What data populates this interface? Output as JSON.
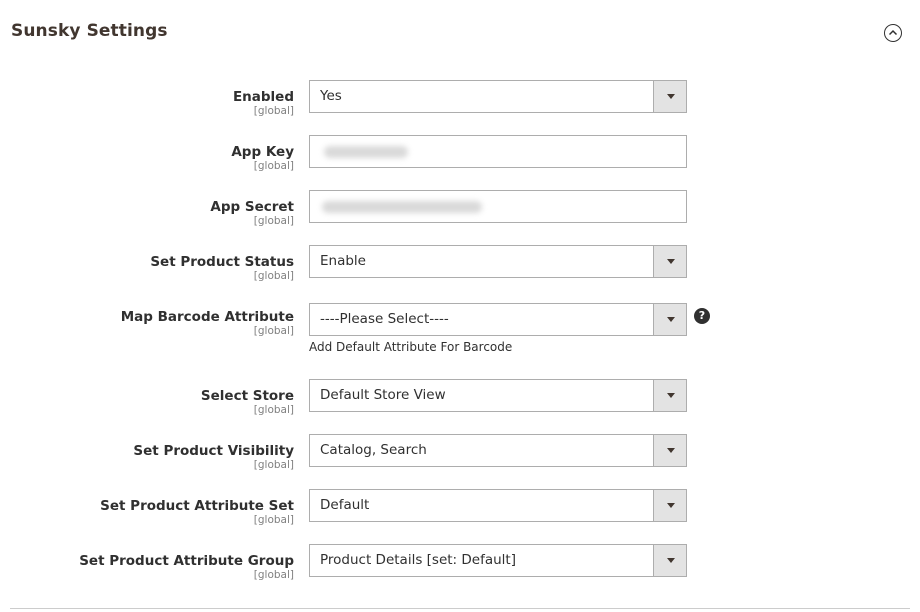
{
  "section": {
    "title": "Sunsky Settings",
    "collapse_icon": "chevron-up-circle-icon"
  },
  "fields": {
    "enabled": {
      "label": "Enabled",
      "scope": "[global]",
      "value": "Yes"
    },
    "app_key": {
      "label": "App Key",
      "scope": "[global]"
    },
    "app_secret": {
      "label": "App Secret",
      "scope": "[global]"
    },
    "product_status": {
      "label": "Set Product Status",
      "scope": "[global]",
      "value": "Enable"
    },
    "barcode_attribute": {
      "label": "Map Barcode Attribute",
      "scope": "[global]",
      "value": "----Please Select----",
      "note": "Add Default Attribute For Barcode",
      "help_icon": "question-circle-icon",
      "help_glyph": "?"
    },
    "store": {
      "label": "Select Store",
      "scope": "[global]",
      "value": "Default Store View"
    },
    "visibility": {
      "label": "Set Product Visibility",
      "scope": "[global]",
      "value": "Catalog, Search"
    },
    "attribute_set": {
      "label": "Set Product Attribute Set",
      "scope": "[global]",
      "value": "Default"
    },
    "attribute_group": {
      "label": "Set Product Attribute Group",
      "scope": "[global]",
      "value": "Product Details [set: Default]"
    }
  }
}
